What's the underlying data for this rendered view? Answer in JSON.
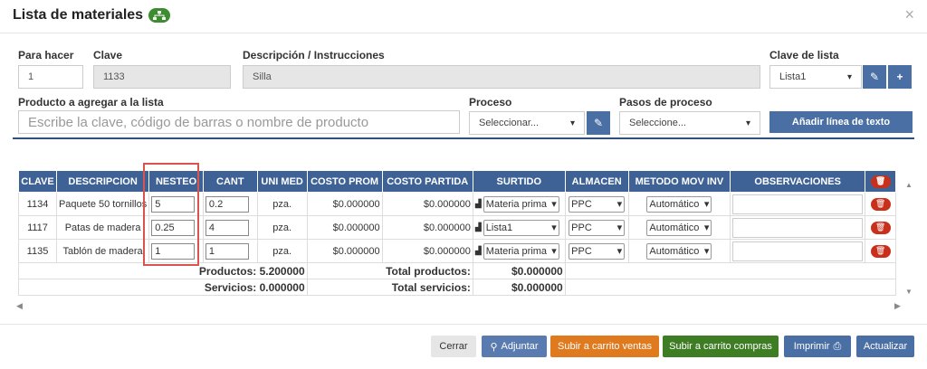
{
  "header": {
    "title": "Lista de materiales",
    "icon": "sitemap-icon",
    "close_label": "×"
  },
  "form": {
    "para_hacer": {
      "label": "Para hacer",
      "value": "1"
    },
    "clave": {
      "label": "Clave",
      "value": "1133"
    },
    "descripcion": {
      "label": "Descripción / Instrucciones",
      "value": "Silla"
    },
    "clave_lista": {
      "label": "Clave de lista",
      "value": "Lista1"
    },
    "producto": {
      "label": "Producto a agregar a la lista",
      "placeholder": "Escribe la clave, código de barras o nombre de producto"
    },
    "proceso": {
      "label": "Proceso",
      "value": "Seleccionar..."
    },
    "pasos": {
      "label": "Pasos de proceso",
      "value": "Seleccione..."
    },
    "add_text_line": "Añadir línea de texto"
  },
  "table": {
    "headers": [
      "CLAVE",
      "DESCRIPCION",
      "NESTEO",
      "CANT",
      "UNI MED",
      "COSTO PROM",
      "COSTO PARTIDA",
      "SURTIDO",
      "ALMACEN",
      "METODO MOV INV",
      "OBSERVACIONES"
    ],
    "rows": [
      {
        "clave": "1134",
        "descripcion": "Paquete 50 tornillos",
        "nesteo": "5",
        "cant": "0.2",
        "uni_med": "pza.",
        "costo_prom": "$0.000000",
        "costo_partida": "$0.000000",
        "surtido": "Materia prima",
        "almacen": "PPC",
        "metodo": "Automático"
      },
      {
        "clave": "1117",
        "descripcion": "Patas de madera",
        "nesteo": "0.25",
        "cant": "4",
        "uni_med": "pza.",
        "costo_prom": "$0.000000",
        "costo_partida": "$0.000000",
        "surtido": "Lista1",
        "almacen": "PPC",
        "metodo": "Automático"
      },
      {
        "clave": "1135",
        "descripcion": "Tablón de madera",
        "nesteo": "1",
        "cant": "1",
        "uni_med": "pza.",
        "costo_prom": "$0.000000",
        "costo_partida": "$0.000000",
        "surtido": "Materia prima",
        "almacen": "PPC",
        "metodo": "Automático"
      }
    ],
    "totals": {
      "productos_label": "Productos: 5.200000",
      "servicios_label": "Servicios: 0.000000",
      "total_productos_label": "Total productos:",
      "total_productos_value": "$0.000000",
      "total_servicios_label": "Total servicios:",
      "total_servicios_value": "$0.000000"
    }
  },
  "footer": {
    "cerrar": "Cerrar",
    "adjuntar": "Adjuntar",
    "carrito_ventas": "Subir a carrito ventas",
    "carrito_compras": "Subir a carrito compras",
    "imprimir": "Imprimir",
    "actualizar": "Actualizar"
  },
  "colors": {
    "primary": "#4a6fa5",
    "header_bg": "#3f6296",
    "orange": "#e07a1f",
    "green": "#3f7d25",
    "delete": "#c9301c",
    "highlight": "#d9534f"
  }
}
